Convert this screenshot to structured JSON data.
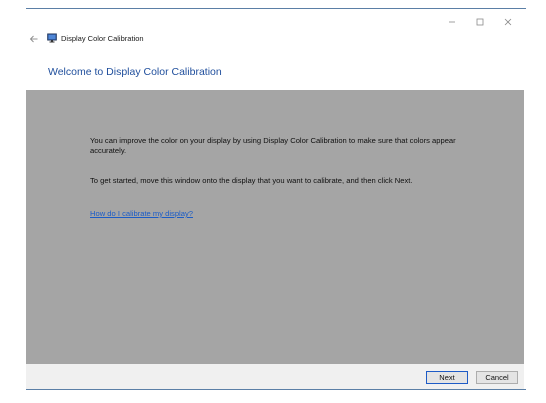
{
  "window": {
    "app_title": "Display Color Calibration",
    "controls": {
      "minimize_icon": "minimize-icon",
      "maximize_icon": "maximize-icon",
      "close_icon": "close-icon"
    },
    "back_icon": "back-arrow-icon",
    "app_icon": "monitor-icon"
  },
  "page": {
    "heading": "Welcome to Display Color Calibration",
    "paragraph1": "You can improve the color on your display by using Display Color Calibration to make sure that colors appear accurately.",
    "paragraph2": "To get started, move this window onto the display that you want to calibrate, and then click Next.",
    "help_link": "How do I calibrate my display?"
  },
  "footer": {
    "next_label": "Next",
    "cancel_label": "Cancel"
  },
  "colors": {
    "heading": "#1f4e9c",
    "content_background": "#a5a5a5",
    "link": "#1b5cc7",
    "footer_background": "#f0f0f0",
    "default_button_border": "#1e5bc6"
  }
}
